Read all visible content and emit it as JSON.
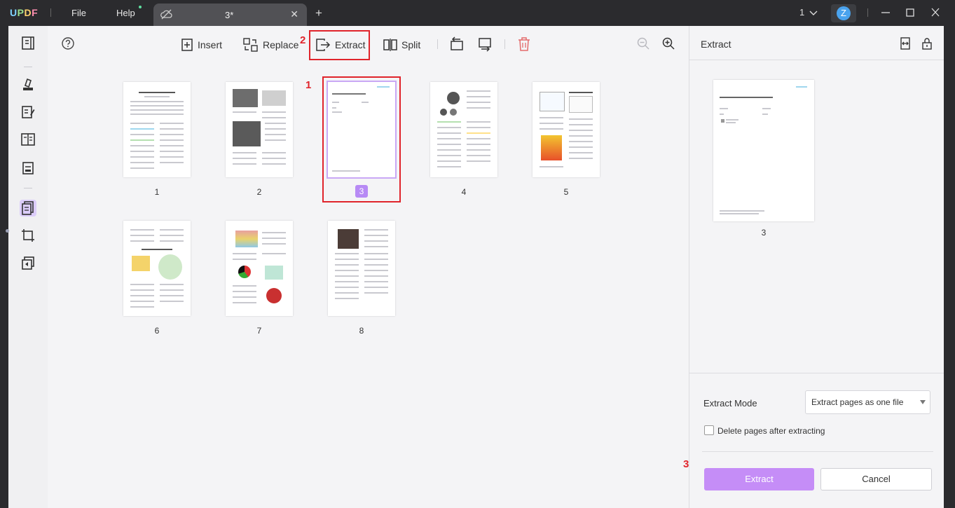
{
  "app": {
    "menu": [
      "File",
      "Help"
    ],
    "tab_title": "3*",
    "new_tab": "+",
    "tab_close": "✕",
    "page_indicator": "1",
    "avatar_initial": "Z"
  },
  "toolbar": {
    "insert": "Insert",
    "replace": "Replace",
    "extract": "Extract",
    "split": "Split"
  },
  "pages": [
    {
      "label": "1"
    },
    {
      "label": "2"
    },
    {
      "label": "3",
      "selected": true
    },
    {
      "label": "4"
    },
    {
      "label": "5"
    },
    {
      "label": "6"
    },
    {
      "label": "7"
    },
    {
      "label": "8"
    }
  ],
  "annotations": [
    "1",
    "2",
    "3"
  ],
  "panel": {
    "title": "Extract",
    "preview_label": "3",
    "extract_mode_label": "Extract Mode",
    "extract_mode_value": "Extract pages as one file",
    "delete_pages_label": "Delete pages after extracting",
    "extract_button": "Extract",
    "cancel_button": "Cancel"
  },
  "colors": {
    "accent": "#c58df7",
    "selected_badge": "#b78af5",
    "annotation": "#e0242b",
    "titlebar": "#2b2b2e"
  }
}
